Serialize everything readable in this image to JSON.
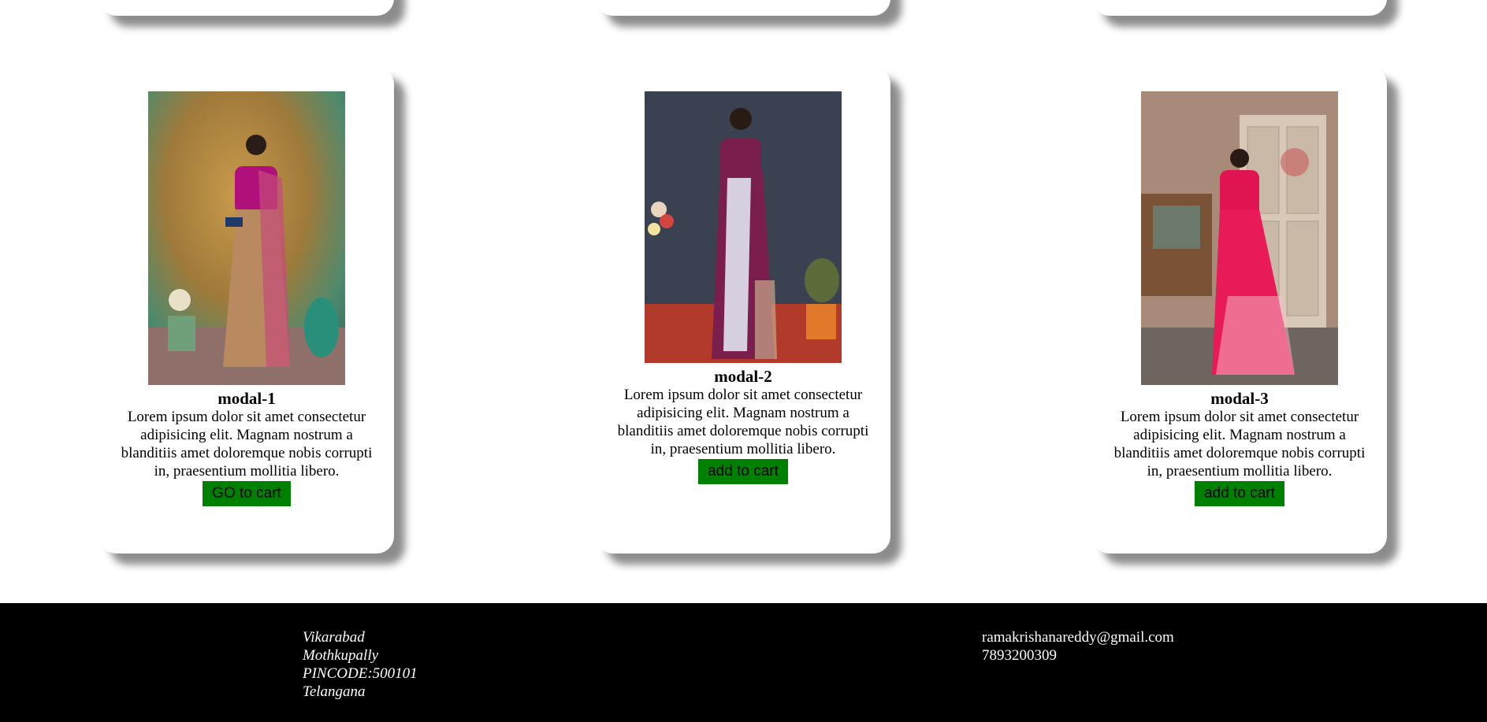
{
  "products": [
    {
      "title": "modal-1",
      "description": "Lorem ipsum dolor sit amet consectetur adipisicing elit. Magnam nostrum a blanditiis amet doloremque nobis corrupti in, praesentium mollitia libero.",
      "button_label": "GO to cart"
    },
    {
      "title": "modal-2",
      "description": "Lorem ipsum dolor sit amet consectetur adipisicing elit. Magnam nostrum a blanditiis amet doloremque nobis corrupti in, praesentium mollitia libero.",
      "button_label": "add to cart"
    },
    {
      "title": "modal-3",
      "description": "Lorem ipsum dolor sit amet consectetur adipisicing elit. Magnam nostrum a blanditiis amet doloremque nobis corrupti in, praesentium mollitia libero.",
      "button_label": "add to cart"
    }
  ],
  "footer": {
    "address": [
      "Vikarabad",
      "Mothkupally",
      "PINCODE:500101",
      "Telangana"
    ],
    "email": "ramakrishanareddy@gmail.com",
    "phone": "7893200309"
  },
  "colors": {
    "button_bg": "#008000",
    "footer_bg": "#000000",
    "footer_text": "#ffffff"
  }
}
